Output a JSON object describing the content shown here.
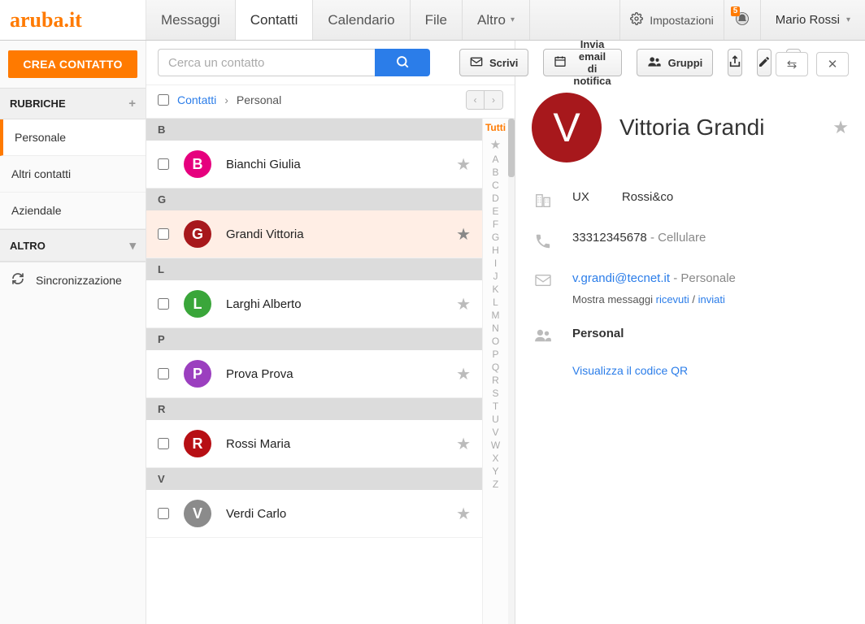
{
  "header": {
    "brand": "aruba.it",
    "nav": {
      "messages": "Messaggi",
      "contacts": "Contatti",
      "calendar": "Calendario",
      "files": "File",
      "more": "Altro"
    },
    "settings": "Impostazioni",
    "notif_count": "5",
    "user": "Mario Rossi"
  },
  "sidebar": {
    "create": "CREA CONTATTO",
    "addressbooks_title": "RUBRICHE",
    "addressbooks": [
      "Personale",
      "Altri contatti",
      "Aziendale"
    ],
    "other_title": "ALTRO",
    "sync": "Sincronizzazione"
  },
  "search": {
    "placeholder": "Cerca un contatto"
  },
  "toolbar": {
    "write": "Scrivi",
    "notify": "Invia email di notifica",
    "groups": "Gruppi"
  },
  "breadcrumb": {
    "root": "Contatti",
    "current": "Personal"
  },
  "alpha_all": "Tutti",
  "sections": [
    {
      "letter": "B",
      "rows": [
        {
          "name": "Bianchi Giulia",
          "initial": "B",
          "color": "#e6007e"
        }
      ]
    },
    {
      "letter": "G",
      "rows": [
        {
          "name": "Grandi Vittoria",
          "initial": "G",
          "color": "#a7181c",
          "selected": true
        }
      ]
    },
    {
      "letter": "L",
      "rows": [
        {
          "name": "Larghi Alberto",
          "initial": "L",
          "color": "#3aa63a"
        }
      ]
    },
    {
      "letter": "P",
      "rows": [
        {
          "name": "Prova Prova",
          "initial": "P",
          "color": "#9b3fbf"
        }
      ]
    },
    {
      "letter": "R",
      "rows": [
        {
          "name": "Rossi Maria",
          "initial": "R",
          "color": "#b70f14"
        }
      ]
    },
    {
      "letter": "V",
      "rows": [
        {
          "name": "Verdi Carlo",
          "initial": "V",
          "color": "#8b8b8b"
        }
      ]
    }
  ],
  "detail": {
    "name": "Vittoria Grandi",
    "initial": "V",
    "role": "UX",
    "company": "Rossi&co",
    "phone": "33312345678",
    "phone_type": "Cellulare",
    "email": "v.grandi@tecnet.it",
    "email_type": "Personale",
    "msg_prefix": "Mostra messaggi",
    "msg_received": "ricevuti",
    "msg_sent": "inviati",
    "group": "Personal",
    "qr": "Visualizza il codice QR"
  }
}
